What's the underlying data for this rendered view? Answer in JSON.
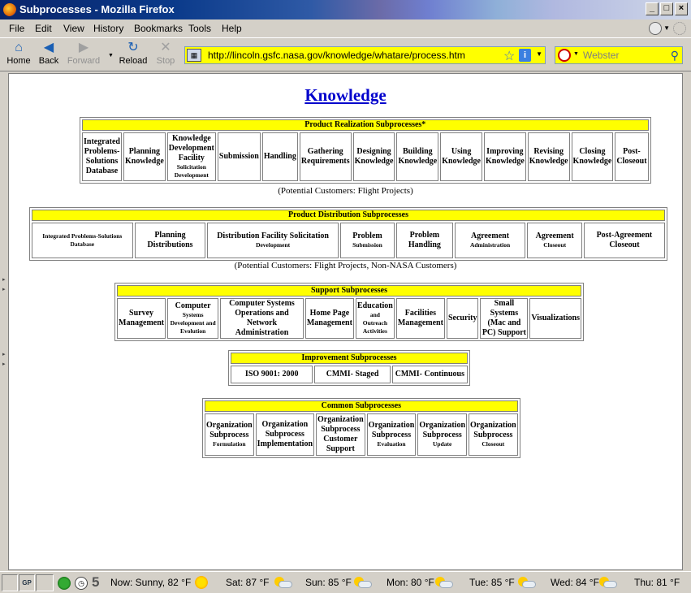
{
  "window": {
    "title": "Subprocesses - Mozilla Firefox",
    "min": "_",
    "max": "□",
    "close": "×"
  },
  "menu": [
    "File",
    "Edit",
    "View",
    "History",
    "Bookmarks",
    "Tools",
    "Help"
  ],
  "nav": {
    "home": "Home",
    "back": "Back",
    "forward": "Forward",
    "reload": "Reload",
    "stop": "Stop"
  },
  "url": "http://lincoln.gsfc.nasa.gov/knowledge/whatare/process.htm",
  "search": {
    "placeholder": "Webster"
  },
  "page": {
    "heading": "Knowledge",
    "realization": {
      "header": "Product Realization Subprocesses*",
      "cells": [
        {
          "main": "Integrated Problems-Solutions Database"
        },
        {
          "main": "Planning Knowledge"
        },
        {
          "main": "Knowledge Development Facility",
          "sub": "Solicitation Development"
        },
        {
          "main": "Submission"
        },
        {
          "main": "Handling"
        },
        {
          "main": "Gathering Requirements"
        },
        {
          "main": "Designing Knowledge"
        },
        {
          "main": "Building Knowledge"
        },
        {
          "main": "Using Knowledge"
        },
        {
          "main": "Improving Knowledge"
        },
        {
          "main": "Revising Knowledge"
        },
        {
          "main": "Closing Knowledge"
        },
        {
          "main": "Post-Closeout"
        }
      ],
      "caption": "(Potential Customers: Flight Projects)"
    },
    "distribution": {
      "header": "Product Distribution Subprocesses",
      "cells": [
        {
          "small": "Integrated Problems-Solutions Database"
        },
        {
          "main": "Planning Distributions"
        },
        {
          "main": "Distribution Facility Solicitation",
          "sub": "Development"
        },
        {
          "main": "Problem",
          "sub": "Submission"
        },
        {
          "main": "Problem Handling"
        },
        {
          "main": "Agreement",
          "sub": "Administration"
        },
        {
          "main": "Agreement",
          "sub": "Closeout"
        },
        {
          "main": "Post-Agreement Closeout"
        }
      ],
      "caption": "(Potential Customers: Flight Projects, Non-NASA Customers)"
    },
    "support": {
      "header": "Support Subprocesses",
      "cells": [
        {
          "main": "Survey Management"
        },
        {
          "main": "Computer",
          "sub": "Systems Development and Evolution"
        },
        {
          "main": "Computer Systems Operations and Network Administration"
        },
        {
          "main": "Home Page Management"
        },
        {
          "main": "Education",
          "sub": "and Outreach Activities"
        },
        {
          "main": "Facilities Management"
        },
        {
          "main": "Security"
        },
        {
          "main": "Small Systems (Mac and PC) Support"
        },
        {
          "main": "Visualizations"
        }
      ]
    },
    "improvement": {
      "header": "Improvement Subprocesses",
      "cells": [
        {
          "main": "ISO 9001: 2000"
        },
        {
          "main": "CMMI- Staged"
        },
        {
          "main": "CMMI- Continuous"
        }
      ]
    },
    "common": {
      "header": "Common Subprocesses",
      "cells": [
        {
          "main": "Organization Subprocess",
          "sub": "Formulation"
        },
        {
          "main": "Organization Subprocess Implementation"
        },
        {
          "main": "Organization Subprocess Customer Support"
        },
        {
          "main": "Organization Subprocess",
          "sub": "Evaluation"
        },
        {
          "main": "Organization Subprocess",
          "sub": "Update"
        },
        {
          "main": "Organization Subprocess",
          "sub": "Closeout"
        }
      ]
    }
  },
  "status": {
    "gp": "GP",
    "five": "5",
    "weather": [
      {
        "text": "Now: Sunny, 82 °F",
        "icon": "sun"
      },
      {
        "text": "Sat: 87 °F",
        "icon": "partly-cloudy"
      },
      {
        "text": "Sun: 85 °F",
        "icon": "partly-cloudy"
      },
      {
        "text": "Mon: 80 °F",
        "icon": "partly-cloudy"
      },
      {
        "text": "Tue: 85 °F",
        "icon": "partly-cloudy"
      },
      {
        "text": "Wed: 84 °F",
        "icon": "partly-cloudy"
      },
      {
        "text": "Thu: 81 °F",
        "icon": "partly-cloudy"
      }
    ]
  }
}
